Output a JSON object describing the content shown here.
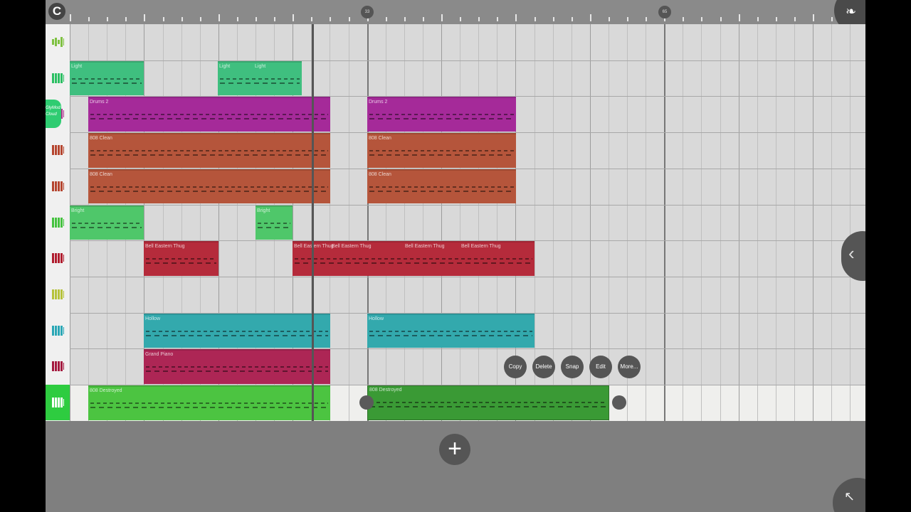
{
  "timeline": {
    "logo": "C",
    "markers": [
      {
        "id": "m33",
        "label": "33"
      },
      {
        "id": "m65",
        "label": "65"
      }
    ]
  },
  "tracks": [
    {
      "icon": "equalizer-icon",
      "color": "#7fc142"
    },
    {
      "icon": "piano-icon",
      "color": "#2bbf63"
    },
    {
      "icon": "piano-icon",
      "color": "#b03090"
    },
    {
      "icon": "drum-pad-icon",
      "color": "#b5452f"
    },
    {
      "icon": "drum-pad-icon",
      "color": "#b5452f"
    },
    {
      "icon": "piano-icon",
      "color": "#45c23f"
    },
    {
      "icon": "piano-icon",
      "color": "#b01c2e"
    },
    {
      "icon": "piano-icon",
      "color": "#b6c23a"
    },
    {
      "icon": "piano-icon",
      "color": "#2aa7b6"
    },
    {
      "icon": "piano-icon",
      "color": "#a4193f"
    },
    {
      "icon": "piano-icon",
      "color": "#2ecc40"
    }
  ],
  "plugin_tab": "GlyMod\nCloud",
  "clips": [
    {
      "track": 1,
      "name": "Light",
      "color": "#3fbf7f"
    },
    {
      "track": 1,
      "name": "Light",
      "color": "#3fbf7f",
      "sub": [
        "Light"
      ]
    },
    {
      "track": 2,
      "name": "Drums 2",
      "color": "#a52a99"
    },
    {
      "track": 2,
      "name": "Drums 2",
      "color": "#a52a99"
    },
    {
      "track": 3,
      "name": "808 Clean",
      "color": "#b5553b"
    },
    {
      "track": 3,
      "name": "808 Clean",
      "color": "#b5553b"
    },
    {
      "track": 4,
      "name": "808 Clean",
      "color": "#b5553b"
    },
    {
      "track": 4,
      "name": "808 Clean",
      "color": "#b5553b"
    },
    {
      "track": 5,
      "name": "Bright",
      "color": "#4fc76a"
    },
    {
      "track": 5,
      "name": "Bright",
      "color": "#4fc76a"
    },
    {
      "track": 6,
      "name": "Bell Eastern Thug",
      "color": "#b52b3b"
    },
    {
      "track": 6,
      "name": "Bell Eastern Thug",
      "color": "#b52b3b",
      "sub": [
        "Bell Eastern Thug",
        "Bell Eastern Thug",
        "Bell Eastern Thug"
      ]
    },
    {
      "track": 8,
      "name": "Hollow",
      "color": "#33a9ad"
    },
    {
      "track": 8,
      "name": "Hollow",
      "color": "#33a9ad"
    },
    {
      "track": 9,
      "name": "Grand Piano",
      "color": "#ad2655"
    },
    {
      "track": 10,
      "name": "808 Destroyed",
      "color": "#4cc441"
    },
    {
      "track": 10,
      "name": "808 Destroyed",
      "color": "#3a9a35",
      "selected": true
    }
  ],
  "context_menu": {
    "copy": "Copy",
    "delete": "Delete",
    "snap": "Snap",
    "edit": "Edit",
    "more": "More..."
  },
  "buttons": {
    "add": "+",
    "side_tab": "‹",
    "corner": "↖"
  }
}
